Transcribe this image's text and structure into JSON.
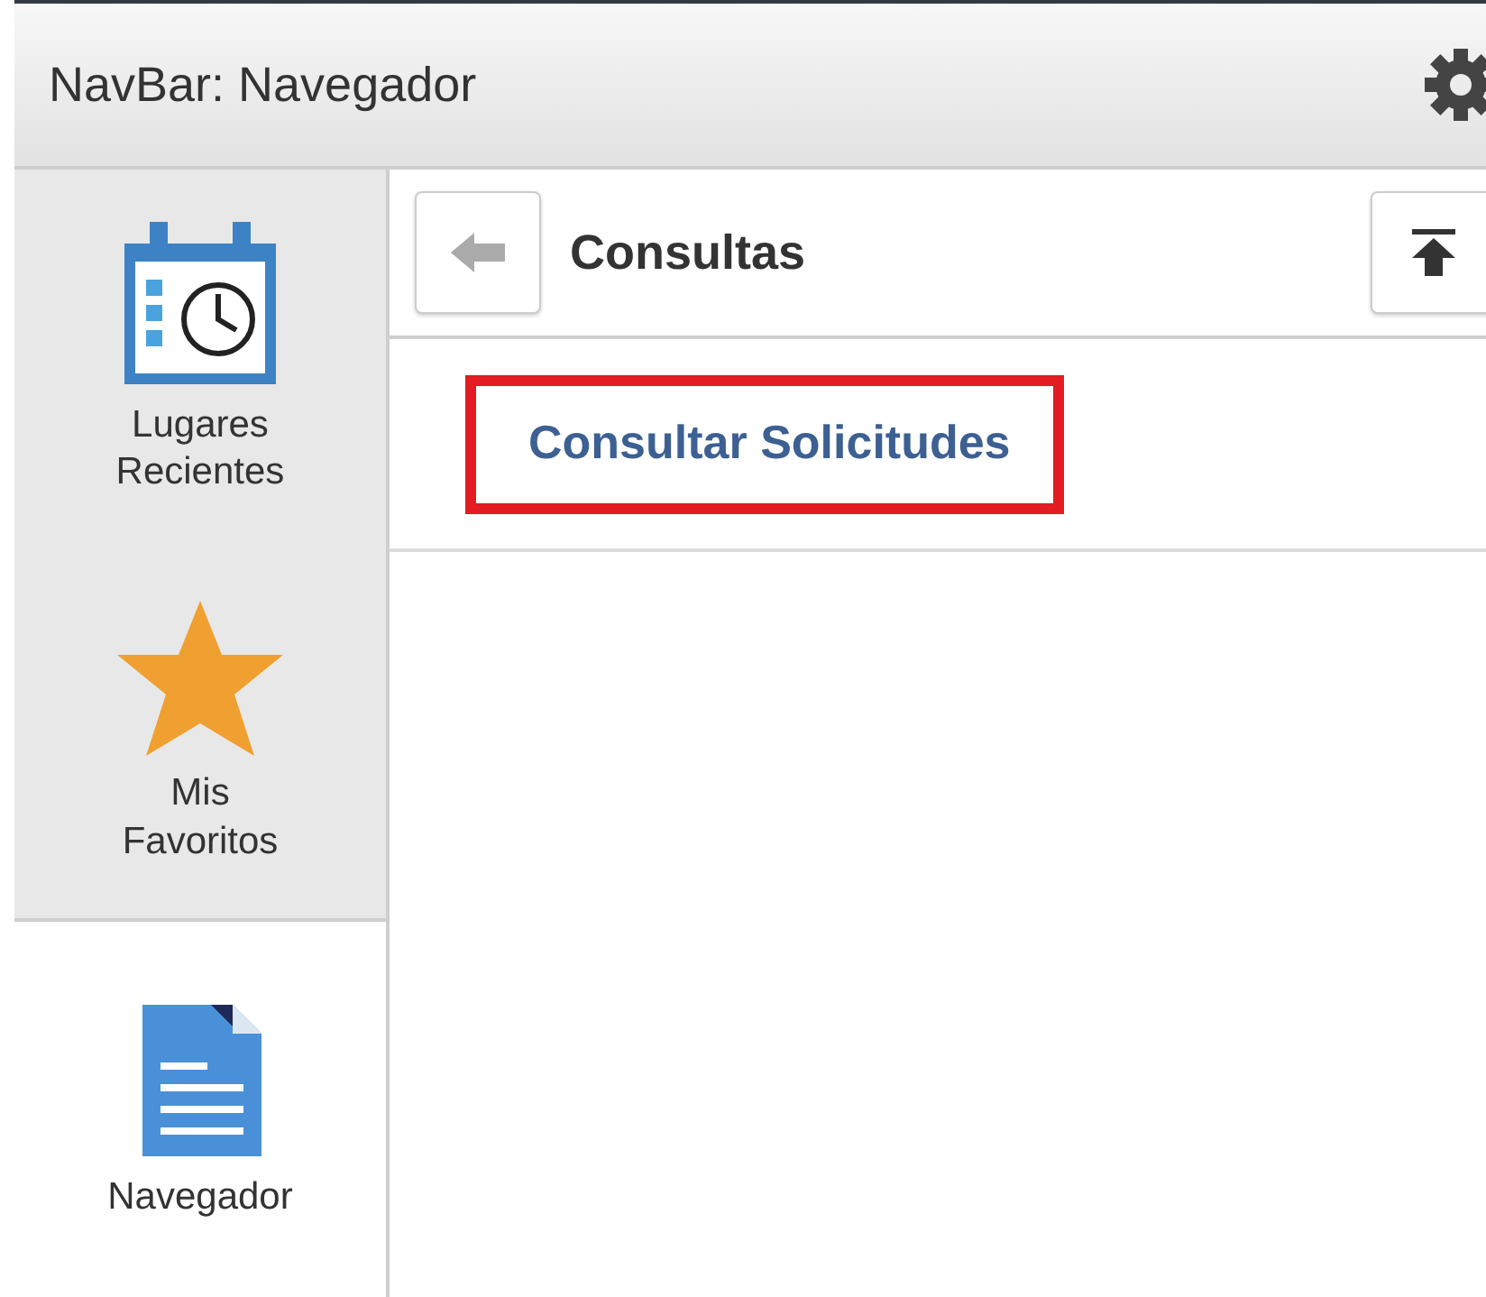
{
  "header": {
    "title": "NavBar: Navegador"
  },
  "sidebar": {
    "items": [
      {
        "kind": "recent",
        "label": "Lugares Recientes",
        "selected": false
      },
      {
        "kind": "favorites",
        "label": "Mis Favoritos",
        "selected": false
      },
      {
        "kind": "navigator",
        "label": "Navegador",
        "selected": true
      }
    ]
  },
  "panel": {
    "title": "Consultas",
    "items": [
      {
        "label": "Consultar Solicitudes",
        "highlighted": true
      }
    ]
  }
}
